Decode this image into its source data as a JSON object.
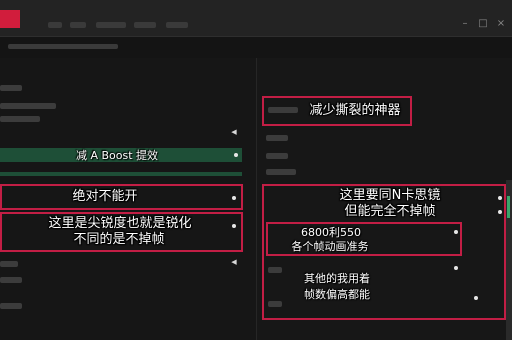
{
  "app": {
    "logo_text": ""
  },
  "annotations": {
    "green_caption": "减 A Boost 提效",
    "never_on": "绝对不能开",
    "sharpness_line1": "这里是尖锐度也就是锐化",
    "sharpness_line2": "不同的是不掉帧",
    "reduce_tearing": "减少撕裂的神器",
    "nvidia_line1": "这里要同N卡思镜",
    "nvidia_line2": "但能完全不掉帧",
    "gpu_line1": "6800利550",
    "gpu_line2": "各个帧动画准务",
    "other_line1": "其他的我用着",
    "other_line2": "帧数偏高都能"
  },
  "icons": {
    "chevron": "chevron-right-icon",
    "logo": "app-logo-icon",
    "minimize": "minimize-icon",
    "maximize": "maximize-icon",
    "close": "close-icon"
  },
  "colors": {
    "accent_red": "#c21e45",
    "highlight_green": "#1e4f37",
    "background": "#141414"
  }
}
